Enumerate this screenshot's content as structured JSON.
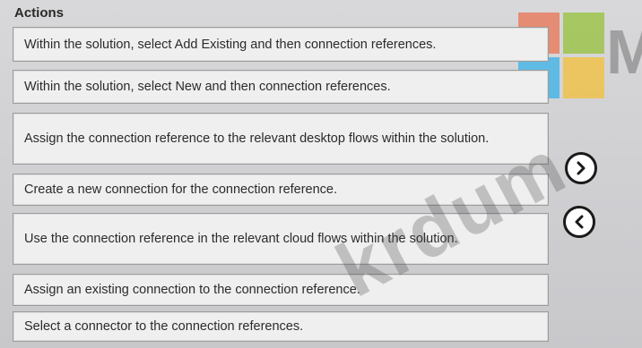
{
  "header": {
    "title": "Actions"
  },
  "actions": [
    {
      "label": "Within the solution, select Add Existing and then connection references."
    },
    {
      "label": "Within the solution, select New and then connection references."
    },
    {
      "label": "Assign the connection reference to the relevant desktop flows within the solution."
    },
    {
      "label": "Create a new connection for the connection reference."
    },
    {
      "label": "Use the connection reference in the relevant cloud flows within the solution."
    },
    {
      "label": "Assign an existing connection to the connection reference."
    },
    {
      "label": "Select a connector to the connection references."
    }
  ],
  "navigation": {
    "move_right_icon": "chevron-right-icon",
    "move_left_icon": "chevron-left-icon"
  },
  "logo": {
    "colors": [
      "#f25022",
      "#7fba00",
      "#00a4ef",
      "#ffb900"
    ]
  },
  "watermark": {
    "text": "krdum",
    "corner_letter": "M"
  }
}
